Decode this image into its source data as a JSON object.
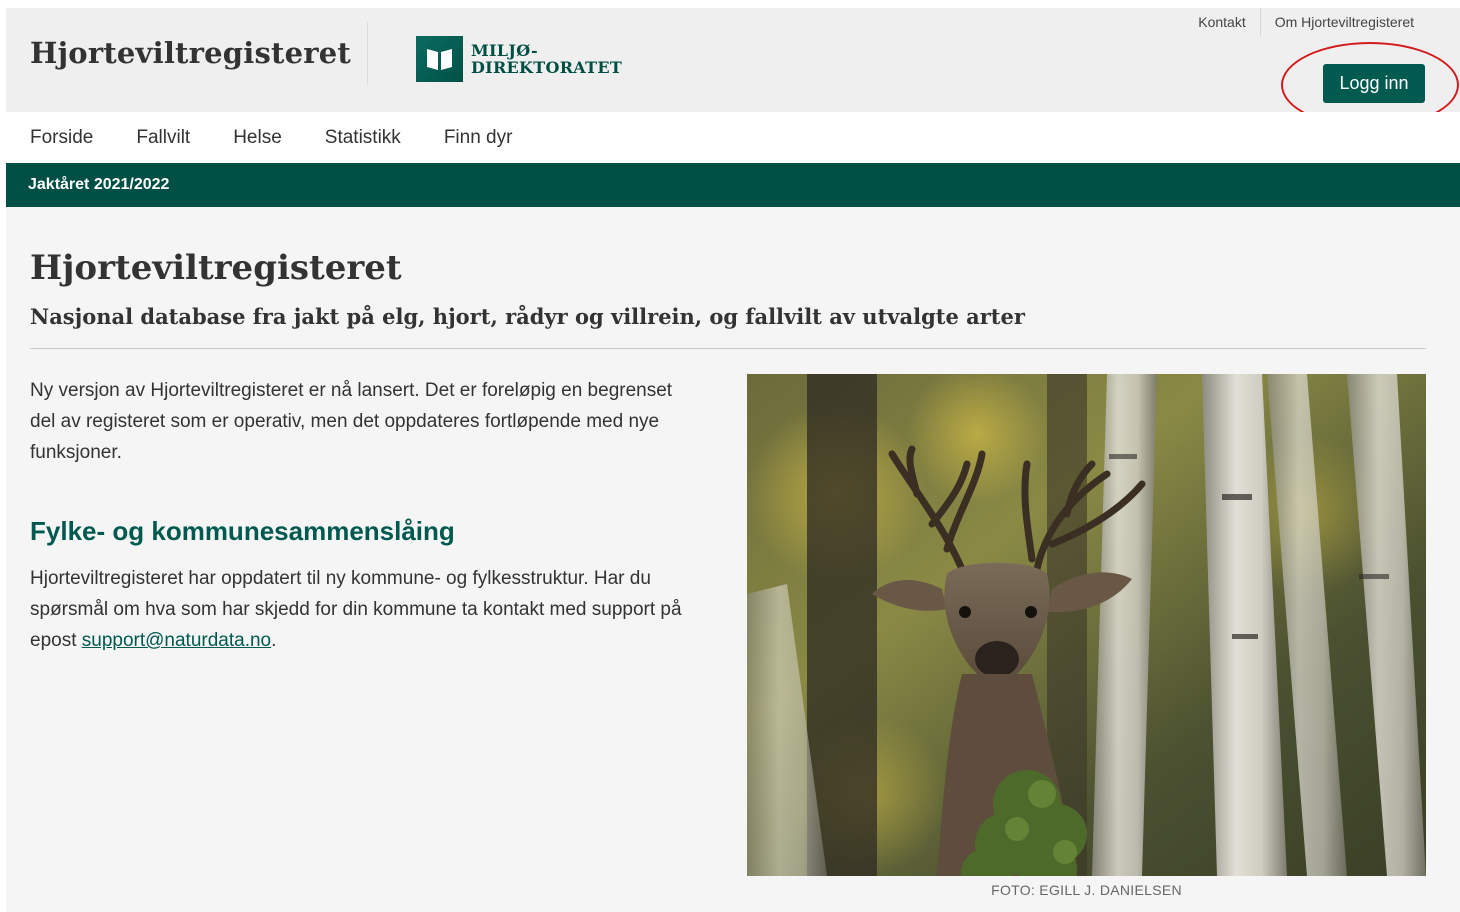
{
  "header": {
    "site_title": "Hjorteviltregisteret",
    "logo": {
      "line1": "MILJØ-",
      "line2": "DIREKTORATET"
    },
    "top_links": [
      "Kontakt",
      "Om Hjorteviltregisteret"
    ],
    "login_label": "Logg inn"
  },
  "nav": {
    "items": [
      "Forside",
      "Fallvilt",
      "Helse",
      "Statistikk",
      "Finn dyr"
    ]
  },
  "season": {
    "label": "Jaktåret 2021/2022"
  },
  "main": {
    "title": "Hjorteviltregisteret",
    "subtitle": "Nasjonal database fra jakt på elg, hjort, rådyr og villrein, og fallvilt av utvalgte arter",
    "intro": "Ny versjon av Hjorteviltregisteret er nå lansert. Det er foreløpig en begrenset del av registeret som er operativ, men det oppdateres fortløpende med nye funksjoner.",
    "section": {
      "heading": "Fylke- og kommunesammenslåing",
      "body_prefix": "Hjorteviltregisteret har oppdatert til ny kommune- og fylkesstruktur. Har du spørsmål om hva som har skjedd for din kommune ta kontakt med support på epost ",
      "email": "support@naturdata.no",
      "body_suffix": "."
    },
    "photo_credit": "FOTO: EGILL J. DANIELSEN"
  },
  "colors": {
    "brand_green": "#004f45",
    "link_green": "#00594f",
    "highlight_red": "#d31a1a"
  }
}
